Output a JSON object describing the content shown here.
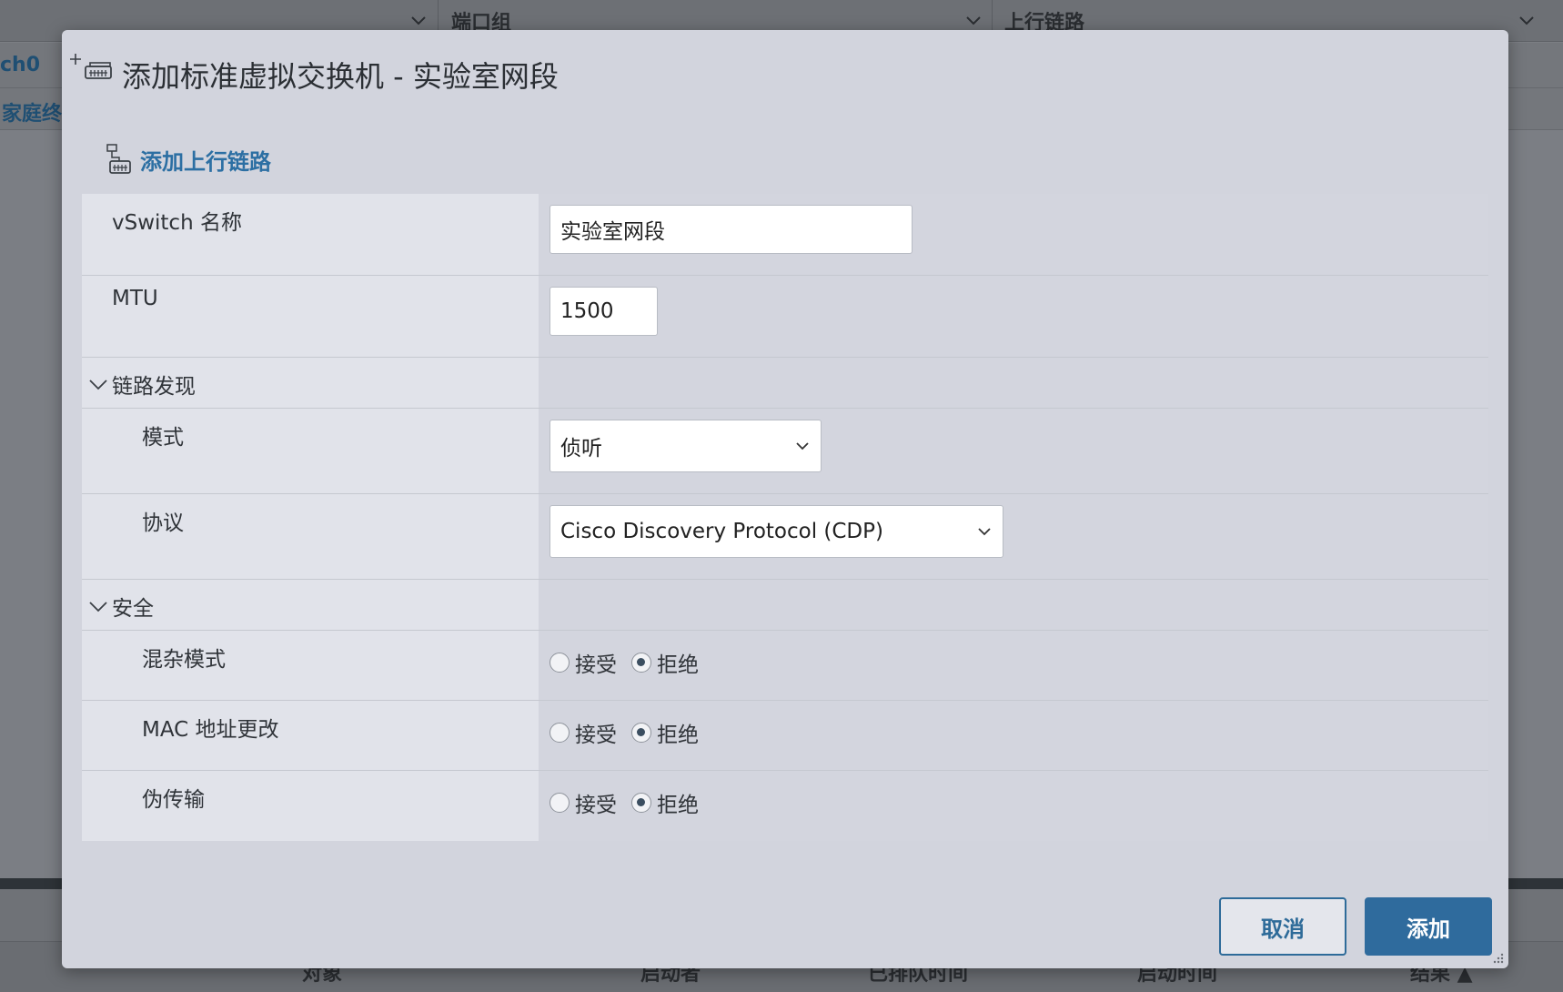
{
  "background": {
    "columns": [
      "端口组",
      "上行链路"
    ],
    "rows": [
      "ch0",
      "家庭终"
    ],
    "footer_columns": [
      "对象",
      "启动者",
      "已排队时间",
      "启动时间",
      "结果 ▲"
    ]
  },
  "dialog": {
    "title": "添加标准虚拟交换机 - 实验室网段",
    "add_uplink_label": "添加上行链路",
    "fields": {
      "vswitch_name": {
        "label": "vSwitch 名称",
        "value": "实验室网段"
      },
      "mtu": {
        "label": "MTU",
        "value": "1500"
      }
    },
    "link_discovery": {
      "section_label": "链路发现",
      "mode": {
        "label": "模式",
        "value": "侦听"
      },
      "protocol": {
        "label": "协议",
        "value": "Cisco Discovery Protocol (CDP)"
      }
    },
    "security": {
      "section_label": "安全",
      "accept_label": "接受",
      "reject_label": "拒绝",
      "items": [
        {
          "label": "混杂模式",
          "selected": "拒绝"
        },
        {
          "label": "MAC 地址更改",
          "selected": "拒绝"
        },
        {
          "label": "伪传输",
          "selected": "拒绝"
        }
      ]
    },
    "buttons": {
      "cancel": "取消",
      "add": "添加"
    }
  },
  "colors": {
    "primary": "#2f6b9d",
    "link": "#2c6fa3",
    "dialog_bg": "#d2d4dd"
  }
}
